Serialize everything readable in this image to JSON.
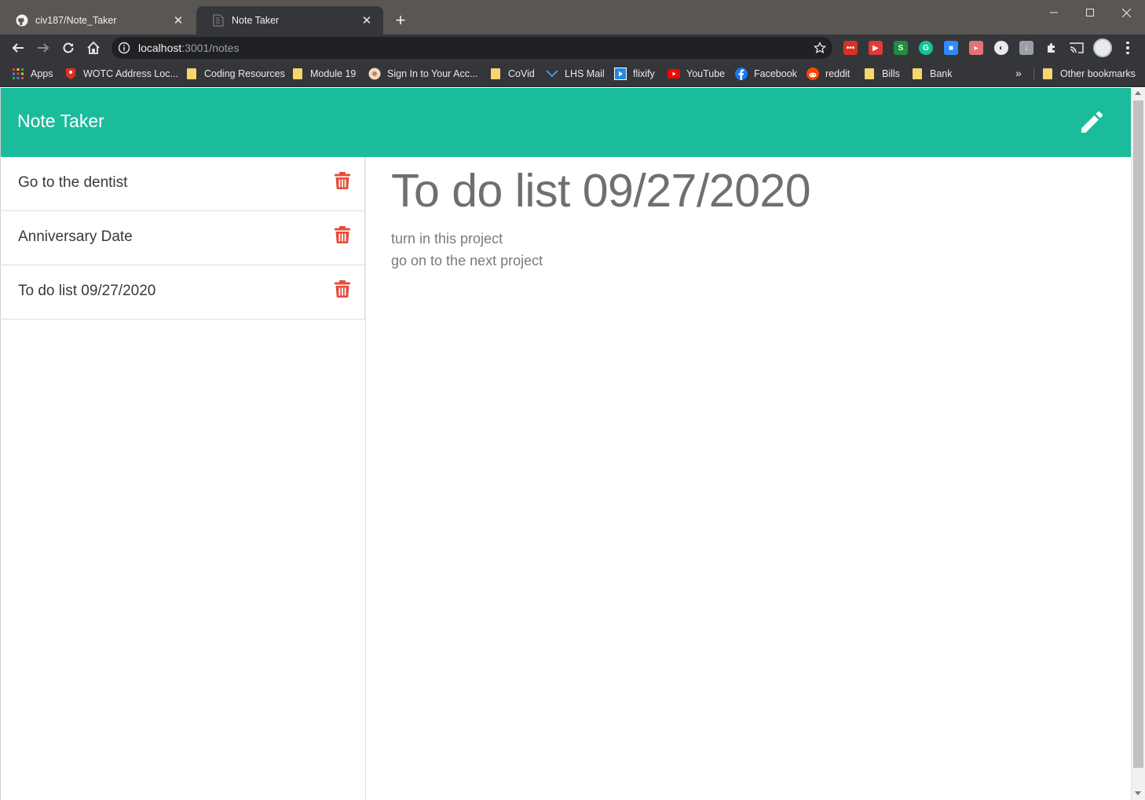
{
  "browser": {
    "tabs": [
      {
        "title": "civ187/Note_Taker",
        "active": false
      },
      {
        "title": "Note Taker",
        "active": true
      }
    ],
    "url": {
      "host": "localhost",
      "path": ":3001/notes"
    },
    "bookmarks": [
      {
        "label": "Apps",
        "icon": "apps-grid-icon"
      },
      {
        "label": "WOTC Address Loc...",
        "icon": "map-pin-icon"
      },
      {
        "label": "Coding Resources",
        "icon": "folder-icon"
      },
      {
        "label": "Module 19",
        "icon": "folder-icon"
      },
      {
        "label": "Sign In to Your Acc...",
        "icon": "account-icon"
      },
      {
        "label": "CoVid",
        "icon": "folder-icon"
      },
      {
        "label": "LHS Mail",
        "icon": "mail-icon"
      },
      {
        "label": "flixify",
        "icon": "play-icon"
      },
      {
        "label": "YouTube",
        "icon": "youtube-icon"
      },
      {
        "label": "Facebook",
        "icon": "facebook-icon"
      },
      {
        "label": "reddit",
        "icon": "reddit-icon"
      },
      {
        "label": "Bills",
        "icon": "folder-icon"
      },
      {
        "label": "Bank",
        "icon": "folder-icon"
      }
    ],
    "bookmarks_overflow": "»",
    "other_bookmarks": "Other bookmarks"
  },
  "app": {
    "brand": "Note Taker",
    "new_note_icon": "pencil-icon",
    "accent_color": "#1abc9c",
    "delete_color": "#e74c3c",
    "notes": [
      {
        "title": "Go to the dentist"
      },
      {
        "title": "Anniversary Date"
      },
      {
        "title": "To do list 09/27/2020"
      }
    ],
    "active_note": {
      "title": "To do list 09/27/2020",
      "text": "turn in this project\ngo on to the next project"
    }
  }
}
